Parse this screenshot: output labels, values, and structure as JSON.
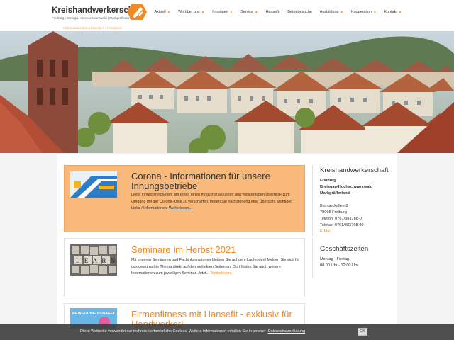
{
  "header": {
    "title": "Kreishandwerkerschaft",
    "subtitle": "Freiburg | Breisgau-Hochschwarzwald | Markgräflerland",
    "brand_color": "#f08a24",
    "nav": [
      {
        "label": "Aktuell",
        "caret": true
      },
      {
        "label": "Wir über uns",
        "caret": true
      },
      {
        "label": "Innungen",
        "caret": true
      },
      {
        "label": "Service",
        "caret": true
      },
      {
        "label": "Hansefit",
        "caret": false
      },
      {
        "label": "Betriebesuche",
        "caret": false
      },
      {
        "label": "Ausbildung",
        "caret": true
      },
      {
        "label": "Kooperation",
        "caret": true
      },
      {
        "label": "Kontakt",
        "caret": true
      }
    ]
  },
  "breadcrumb": "KREISHANDWERKERSCHAFT / FREIBURG",
  "posts": [
    {
      "title": "Corona - Informationen für unsere Innungsbetriebe",
      "text": "Liebe Innungsmitglieder, um Ihnen einen möglichst aktuellen und vollständigen Überblick zum Umgang mit der Corona-Krise zu verschaffen, finden Sie nachstehend eine Übersicht wichtiger Links / Informationen.",
      "more": "Weiterlesen..."
    },
    {
      "title": "Seminare im Herbst 2021",
      "text": "Mit unseren Seminaren und Fachinformationen bleiben Sie auf dem Laufenden! Melden Sie sich für das gewünschte Thema direkt auf den verlinkten Seiten an. Dort finden Sie auch weitere Informationen zum jeweiligen Seminar. Jetzt...",
      "more": "Weiterlesen...",
      "thumb_letters": "LEARN"
    },
    {
      "title": "Firmenfitness mit Hansefit - exklusiv für Handwerker!",
      "thumb_text": "BEWEGUNG SCHAFFT"
    }
  ],
  "sidebar": {
    "contact": {
      "title": "Kreishandwerkerschaft",
      "org_lines": [
        "Freiburg",
        "Breisgau-Hochschwarzwald",
        "Markgräflerland"
      ],
      "street": "Bismarckallee 8",
      "city": "79098 Freiburg",
      "phone": "Telefon: 0761/383768-0",
      "fax": "Telefax: 0761/383768-99",
      "email": "E-Mail"
    },
    "hours": {
      "title": "Geschäftszeiten",
      "days": "Montag - Freitag",
      "time": "08:00 Uhr - 12:00 Uhr"
    }
  },
  "cookie": {
    "text": "Diese Webseite verwendet nur technisch erforderliche Cookies. Weitere Informationen erhalten Sie in unserer",
    "link": "Datenschutzerklärung",
    "ok": "OK"
  }
}
